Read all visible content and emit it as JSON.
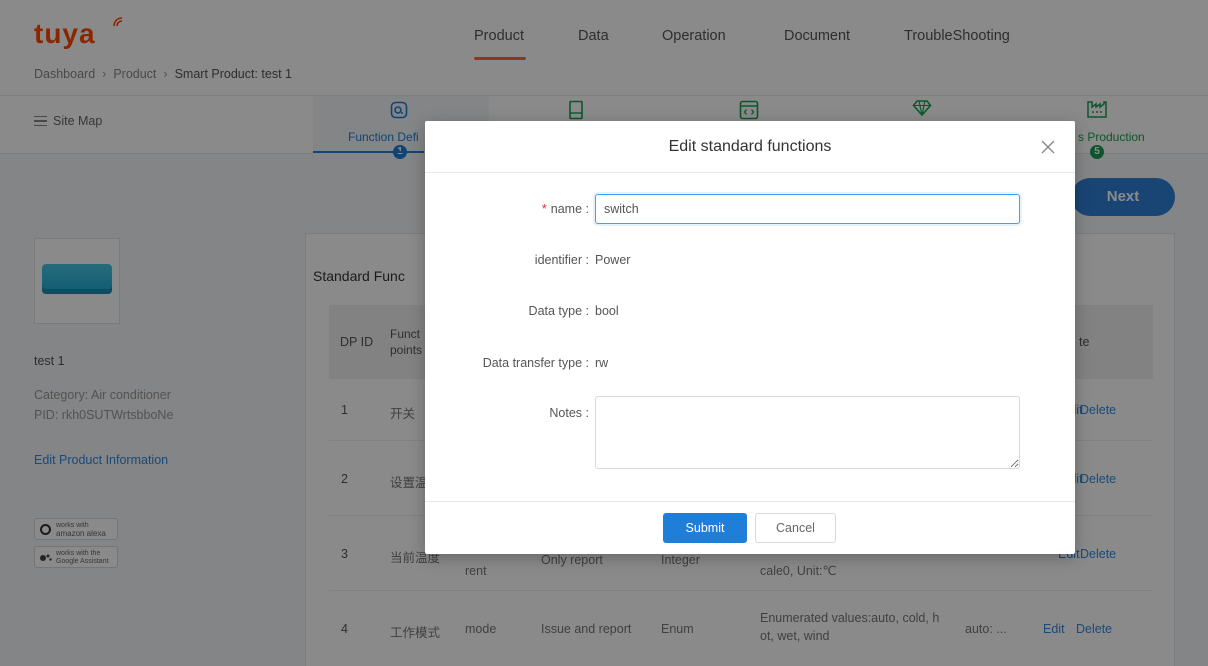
{
  "logo": {
    "text": "tuya"
  },
  "header": {
    "nav": [
      "Product",
      "Data",
      "Operation",
      "Document",
      "TroubleShooting"
    ],
    "active_nav": "Product",
    "accent_color": "#ff6a2b"
  },
  "breadcrumb": [
    "Dashboard",
    "Product",
    "Smart Product: test 1"
  ],
  "stepbar": {
    "sitemap_label": "Site Map",
    "step1_label": "Function Defi",
    "step1_number": "1",
    "step5_label": "s Production",
    "step5_number": "5",
    "step_color": "#1e7ed8",
    "done_color": "#18a054"
  },
  "product": {
    "name": "test 1",
    "category": "Category: Air conditioner",
    "pid": "PID: rkh0SUTWrtsbboNe",
    "edit_link": "Edit Product Information",
    "badges": [
      {
        "icon": "amazon-alexa-icon",
        "line1": "works with",
        "line2": "amazon alexa"
      },
      {
        "icon": "google-assistant-icon",
        "line1": "works with the",
        "line2": "Google Assistant"
      }
    ]
  },
  "next_button": "Next",
  "table": {
    "title": "Standard Func",
    "headers": {
      "dp_id": "DP ID",
      "points_line1": "Funct",
      "points_line2": "points",
      "note": "te"
    },
    "rows": [
      {
        "id": "1",
        "name": "开关",
        "edit": "Edit",
        "delete": "Delete"
      },
      {
        "id": "2",
        "name": "设置温",
        "edit": "Edit",
        "delete": "Delete"
      },
      {
        "id": "3",
        "name": "当前温度",
        "identifier": "rent",
        "transfer": "Only report",
        "type": "Integer",
        "values": "cale0, Unit:℃",
        "edit": "Edit",
        "delete": "Delete"
      },
      {
        "id": "4",
        "name": "工作模式",
        "identifier": "mode",
        "transfer": "Issue and report",
        "type": "Enum",
        "values_line1": "Enumerated values:auto, cold, h",
        "values_line2": "ot, wet, wind",
        "remark": "auto: ...",
        "edit": "Edit",
        "delete": "Delete"
      }
    ]
  },
  "modal": {
    "title": "Edit standard functions",
    "name_label": "name :",
    "name_value": "switch",
    "identifier_label": "identifier :",
    "identifier_value": "Power",
    "datatype_label": "Data type :",
    "datatype_value": "bool",
    "transfer_label": "Data transfer type :",
    "transfer_value": "rw",
    "notes_label": "Notes :",
    "notes_value": "",
    "submit_label": "Submit",
    "cancel_label": "Cancel"
  }
}
